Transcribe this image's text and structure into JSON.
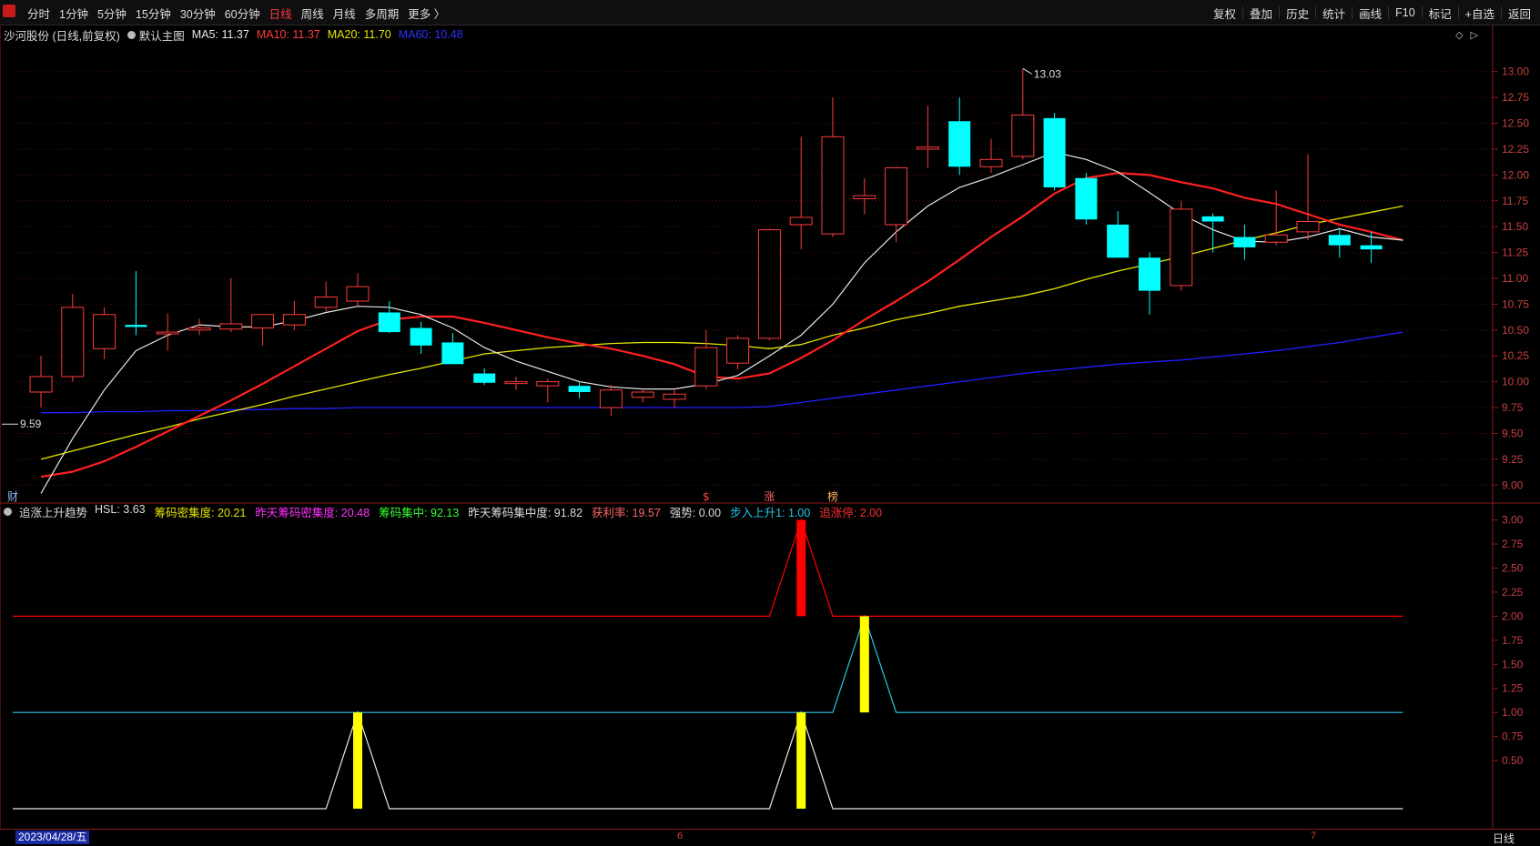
{
  "toolbar": {
    "periods": [
      "分时",
      "1分钟",
      "5分钟",
      "15分钟",
      "30分钟",
      "60分钟",
      "日线",
      "周线",
      "月线",
      "多周期",
      "更多 〉"
    ],
    "active_period": "日线",
    "tools": [
      "复权",
      "叠加",
      "历史",
      "统计",
      "画线",
      "F10",
      "标记",
      "+自选",
      "返回"
    ]
  },
  "main_legend": {
    "stock": "沙河股份 (日线,前复权)",
    "template": "默认主图",
    "ma5": "MA5: 11.37",
    "ma10": "MA10: 11.37",
    "ma20": "MA20: 11.70",
    "ma60": "MA60: 10.48"
  },
  "sub_legend": {
    "name": "追涨上升趋势",
    "items": [
      {
        "text": "HSL: 3.63",
        "color": "#dddddd"
      },
      {
        "text": "筹码密集度: 20.21",
        "color": "#e6e600"
      },
      {
        "text": "昨天筹码密集度: 20.48",
        "color": "#ff33ff"
      },
      {
        "text": "筹码集中: 92.13",
        "color": "#33ff33"
      },
      {
        "text": "昨天筹码集中度: 91.82",
        "color": "#dddddd"
      },
      {
        "text": "获利率: 19.57",
        "color": "#ff6666"
      },
      {
        "text": "强势: 0.00",
        "color": "#dddddd"
      },
      {
        "text": "步入上升1: 1.00",
        "color": "#22c8e6"
      },
      {
        "text": "追涨停: 2.00",
        "color": "#ff3030"
      }
    ]
  },
  "markers": {
    "cai": "财",
    "s": "$",
    "zhang": "涨",
    "bang": "榜"
  },
  "date_bar": {
    "current": "2023/04/28/五",
    "month_6": "6",
    "month_7": "7",
    "period": "日线"
  },
  "colors": {
    "up": "#ff3b3b",
    "down": "#00ffff",
    "ma5": "#e8e8e8",
    "ma10": "#ff2020",
    "ma20": "#e6e600",
    "ma60": "#2020ff",
    "cyan_line": "#22c8e6"
  },
  "chart_data": [
    {
      "type": "candlestick",
      "ylim": [
        8.8,
        13.2
      ],
      "y_ticks": [
        "9.00",
        "9.25",
        "9.50",
        "9.75",
        "10.00",
        "10.25",
        "10.50",
        "10.75",
        "11.00",
        "11.25",
        "11.50",
        "11.75",
        "12.00",
        "12.25",
        "12.50",
        "12.75",
        "13.00"
      ],
      "annotations": {
        "high_label": "13.03",
        "low_label": "9.59"
      },
      "candles": [
        {
          "o": 9.9,
          "h": 10.25,
          "l": 9.75,
          "c": 10.05
        },
        {
          "o": 10.05,
          "h": 10.85,
          "l": 10.0,
          "c": 10.72
        },
        {
          "o": 10.32,
          "h": 10.72,
          "l": 10.22,
          "c": 10.65
        },
        {
          "o": 10.55,
          "h": 11.07,
          "l": 10.45,
          "c": 10.53
        },
        {
          "o": 10.47,
          "h": 10.66,
          "l": 10.3,
          "c": 10.48
        },
        {
          "o": 10.5,
          "h": 10.61,
          "l": 10.45,
          "c": 10.52
        },
        {
          "o": 10.51,
          "h": 11.0,
          "l": 10.48,
          "c": 10.56
        },
        {
          "o": 10.52,
          "h": 10.65,
          "l": 10.35,
          "c": 10.65
        },
        {
          "o": 10.55,
          "h": 10.78,
          "l": 10.5,
          "c": 10.65
        },
        {
          "o": 10.72,
          "h": 10.97,
          "l": 10.68,
          "c": 10.82
        },
        {
          "o": 10.78,
          "h": 11.05,
          "l": 10.73,
          "c": 10.92
        },
        {
          "o": 10.67,
          "h": 10.78,
          "l": 10.47,
          "c": 10.48
        },
        {
          "o": 10.52,
          "h": 10.58,
          "l": 10.27,
          "c": 10.35
        },
        {
          "o": 10.38,
          "h": 10.47,
          "l": 10.17,
          "c": 10.17
        },
        {
          "o": 10.08,
          "h": 10.13,
          "l": 9.97,
          "c": 9.99
        },
        {
          "o": 10.0,
          "h": 10.05,
          "l": 9.92,
          "c": 10.0
        },
        {
          "o": 9.96,
          "h": 10.03,
          "l": 9.8,
          "c": 10.0
        },
        {
          "o": 9.96,
          "h": 10.0,
          "l": 9.84,
          "c": 9.9
        },
        {
          "o": 9.75,
          "h": 9.97,
          "l": 9.67,
          "c": 9.92
        },
        {
          "o": 9.85,
          "h": 9.93,
          "l": 9.8,
          "c": 9.9
        },
        {
          "o": 9.83,
          "h": 9.92,
          "l": 9.75,
          "c": 9.88
        },
        {
          "o": 9.96,
          "h": 10.5,
          "l": 9.93,
          "c": 10.33
        },
        {
          "o": 10.18,
          "h": 10.45,
          "l": 10.12,
          "c": 10.42
        },
        {
          "o": 10.42,
          "h": 11.48,
          "l": 10.4,
          "c": 11.47
        },
        {
          "o": 11.52,
          "h": 12.37,
          "l": 11.28,
          "c": 11.59
        },
        {
          "o": 11.43,
          "h": 12.75,
          "l": 11.4,
          "c": 12.37
        },
        {
          "o": 11.77,
          "h": 11.97,
          "l": 11.62,
          "c": 11.8
        },
        {
          "o": 11.52,
          "h": 12.08,
          "l": 11.35,
          "c": 12.07
        },
        {
          "o": 12.25,
          "h": 12.67,
          "l": 12.07,
          "c": 12.27
        },
        {
          "o": 12.52,
          "h": 12.75,
          "l": 12.0,
          "c": 12.08
        },
        {
          "o": 12.08,
          "h": 12.35,
          "l": 12.02,
          "c": 12.15
        },
        {
          "o": 12.18,
          "h": 13.03,
          "l": 12.15,
          "c": 12.58
        },
        {
          "o": 12.55,
          "h": 12.6,
          "l": 11.85,
          "c": 11.88
        },
        {
          "o": 11.97,
          "h": 12.02,
          "l": 11.52,
          "c": 11.57
        },
        {
          "o": 11.52,
          "h": 11.65,
          "l": 11.2,
          "c": 11.2
        },
        {
          "o": 11.2,
          "h": 11.25,
          "l": 10.65,
          "c": 10.88
        },
        {
          "o": 10.93,
          "h": 11.75,
          "l": 10.88,
          "c": 11.67
        },
        {
          "o": 11.6,
          "h": 11.63,
          "l": 11.25,
          "c": 11.55
        },
        {
          "o": 11.4,
          "h": 11.52,
          "l": 11.18,
          "c": 11.3
        },
        {
          "o": 11.35,
          "h": 11.85,
          "l": 11.32,
          "c": 11.42
        },
        {
          "o": 11.45,
          "h": 12.2,
          "l": 11.37,
          "c": 11.55
        },
        {
          "o": 11.42,
          "h": 11.49,
          "l": 11.2,
          "c": 11.32
        },
        {
          "o": 11.32,
          "h": 11.45,
          "l": 11.15,
          "c": 11.28
        }
      ],
      "ma5": [
        8.92,
        9.45,
        9.92,
        10.3,
        10.45,
        10.55,
        10.53,
        10.53,
        10.59,
        10.67,
        10.73,
        10.72,
        10.65,
        10.52,
        10.33,
        10.2,
        10.1,
        10.0,
        9.95,
        9.93,
        9.93,
        9.98,
        10.06,
        10.25,
        10.45,
        10.75,
        11.15,
        11.45,
        11.7,
        11.88,
        11.98,
        12.1,
        12.22,
        12.15,
        12.03,
        11.83,
        11.62,
        11.47,
        11.36,
        11.35,
        11.4,
        11.48,
        11.4,
        11.37
      ],
      "ma10": [
        9.08,
        9.13,
        9.23,
        9.37,
        9.52,
        9.67,
        9.82,
        9.98,
        10.15,
        10.32,
        10.49,
        10.6,
        10.63,
        10.63,
        10.57,
        10.5,
        10.43,
        10.37,
        10.32,
        10.25,
        10.17,
        10.05,
        10.03,
        10.08,
        10.23,
        10.4,
        10.6,
        10.78,
        10.97,
        11.18,
        11.4,
        11.6,
        11.82,
        11.97,
        12.02,
        12.0,
        11.93,
        11.87,
        11.78,
        11.72,
        11.62,
        11.52,
        11.45,
        11.37
      ],
      "ma20": [
        9.25,
        9.33,
        9.41,
        9.49,
        9.56,
        9.64,
        9.71,
        9.78,
        9.86,
        9.93,
        10.0,
        10.07,
        10.13,
        10.2,
        10.27,
        10.3,
        10.33,
        10.35,
        10.37,
        10.38,
        10.38,
        10.37,
        10.35,
        10.32,
        10.36,
        10.45,
        10.52,
        10.6,
        10.66,
        10.73,
        10.78,
        10.83,
        10.9,
        10.99,
        11.07,
        11.14,
        11.21,
        11.29,
        11.37,
        11.44,
        11.52,
        11.58,
        11.64,
        11.7
      ],
      "ma60": [
        9.7,
        9.7,
        9.71,
        9.71,
        9.72,
        9.72,
        9.73,
        9.73,
        9.74,
        9.74,
        9.75,
        9.75,
        9.75,
        9.75,
        9.75,
        9.75,
        9.75,
        9.75,
        9.75,
        9.75,
        9.75,
        9.75,
        9.75,
        9.76,
        9.8,
        9.84,
        9.88,
        9.92,
        9.96,
        10.0,
        10.04,
        10.08,
        10.11,
        10.14,
        10.17,
        10.19,
        10.21,
        10.24,
        10.27,
        10.3,
        10.34,
        10.38,
        10.43,
        10.48
      ]
    },
    {
      "type": "bar",
      "title": "追涨上升趋势",
      "ylim": [
        0,
        3.1
      ],
      "y_ticks": [
        "0.50",
        "0.75",
        "1.00",
        "1.25",
        "1.50",
        "1.75",
        "2.00",
        "2.25",
        "2.50",
        "2.75",
        "3.00"
      ],
      "series": [
        {
          "name": "追涨停",
          "values": [
            0,
            0,
            0,
            0,
            0,
            0,
            0,
            0,
            0,
            0,
            0,
            0,
            0,
            0,
            0,
            0,
            0,
            0,
            0,
            0,
            0,
            0,
            0,
            0,
            3,
            0,
            0,
            0,
            0,
            0,
            0,
            0,
            0,
            0,
            0,
            0,
            0,
            0,
            0,
            0,
            0,
            0,
            0,
            0
          ],
          "line": [
            2,
            2,
            2,
            2,
            2,
            2,
            2,
            2,
            2,
            2,
            2,
            2,
            2,
            2,
            2,
            2,
            2,
            2,
            2,
            2,
            2,
            2,
            2,
            2,
            3,
            2,
            2,
            2,
            2,
            2,
            2,
            2,
            2,
            2,
            2,
            2,
            2,
            2,
            2,
            2,
            2,
            2,
            2,
            2
          ],
          "color": "#ff0000"
        },
        {
          "name": "步入上升1",
          "values": [
            0,
            0,
            0,
            0,
            0,
            0,
            0,
            0,
            0,
            0,
            0,
            0,
            0,
            0,
            0,
            0,
            0,
            0,
            0,
            0,
            0,
            0,
            0,
            0,
            0,
            0,
            2,
            0,
            0,
            0,
            0,
            0,
            0,
            0,
            0,
            0,
            0,
            0,
            0,
            0,
            0,
            0,
            0,
            0
          ],
          "line": [
            1,
            1,
            1,
            1,
            1,
            1,
            1,
            1,
            1,
            1,
            1,
            1,
            1,
            1,
            1,
            1,
            1,
            1,
            1,
            1,
            1,
            1,
            1,
            1,
            1,
            1,
            2,
            1,
            1,
            1,
            1,
            1,
            1,
            1,
            1,
            1,
            1,
            1,
            1,
            1,
            1,
            1,
            1,
            1
          ],
          "color": "#22c8e6"
        },
        {
          "name": "强势",
          "values": [
            0,
            0,
            0,
            0,
            0,
            0,
            0,
            0,
            0,
            0,
            1,
            0,
            0,
            0,
            0,
            0,
            0,
            0,
            0,
            0,
            0,
            0,
            0,
            0,
            1,
            0,
            0,
            0,
            0,
            0,
            0,
            0,
            0,
            0,
            0,
            0,
            0,
            0,
            0,
            0,
            0,
            0,
            0,
            0
          ],
          "line": [
            0,
            0,
            0,
            0,
            0,
            0,
            0,
            0,
            0,
            0,
            1,
            0,
            0,
            0,
            0,
            0,
            0,
            0,
            0,
            0,
            0,
            0,
            0,
            0,
            1,
            0,
            0,
            0,
            0,
            0,
            0,
            0,
            0,
            0,
            0,
            0,
            0,
            0,
            0,
            0,
            0,
            0,
            0,
            0
          ],
          "color": "#e8e8e8"
        }
      ]
    }
  ]
}
